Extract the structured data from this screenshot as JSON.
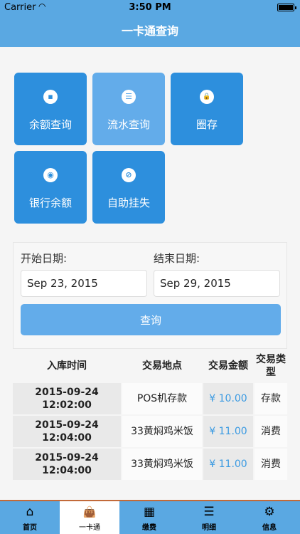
{
  "status_bar": {
    "carrier": "Carrier",
    "time": "3:50 PM"
  },
  "nav": {
    "title": "一卡通查询"
  },
  "tiles": [
    {
      "label": "余额查询",
      "icon": "chat-bubble-icon",
      "glyph": "▪"
    },
    {
      "label": "流水查询",
      "icon": "list-icon",
      "glyph": "☰"
    },
    {
      "label": "圈存",
      "icon": "lock-icon",
      "glyph": "🔒"
    },
    {
      "label": "银行余额",
      "icon": "eye-icon",
      "glyph": "◉"
    },
    {
      "label": "自助挂失",
      "icon": "ban-icon",
      "glyph": "⊘"
    }
  ],
  "query": {
    "start_label": "开始日期:",
    "start_value": "Sep 23, 2015",
    "end_label": "结束日期:",
    "end_value": "Sep 29, 2015",
    "button": "查询"
  },
  "table": {
    "headers": [
      "入库时间",
      "交易地点",
      "交易金额",
      "交易类型"
    ],
    "rows": [
      {
        "time": "2015-09-24 12:02:00",
        "place": "POS机存款",
        "amount": "¥ 10.00",
        "type": "存款"
      },
      {
        "time": "2015-09-24 12:04:00",
        "place": "33黄焖鸡米饭",
        "amount": "¥ 11.00",
        "type": "消费"
      },
      {
        "time": "2015-09-24 12:04:00",
        "place": "33黄焖鸡米饭",
        "amount": "¥ 11.00",
        "type": "消费"
      }
    ]
  },
  "tabbar": [
    {
      "label": "首页",
      "icon": "home-icon",
      "glyph": "⌂"
    },
    {
      "label": "一卡通",
      "icon": "bag-icon",
      "glyph": "👜"
    },
    {
      "label": "缴费",
      "icon": "grid-icon",
      "glyph": "▦"
    },
    {
      "label": "明细",
      "icon": "list-icon",
      "glyph": "☰"
    },
    {
      "label": "信息",
      "icon": "gear-icon",
      "glyph": "⚙"
    }
  ],
  "colors": {
    "accent": "#5aa8e2",
    "tile": "#2d8fdd",
    "tile_active": "#63acea",
    "amount": "#3a9ae2"
  }
}
